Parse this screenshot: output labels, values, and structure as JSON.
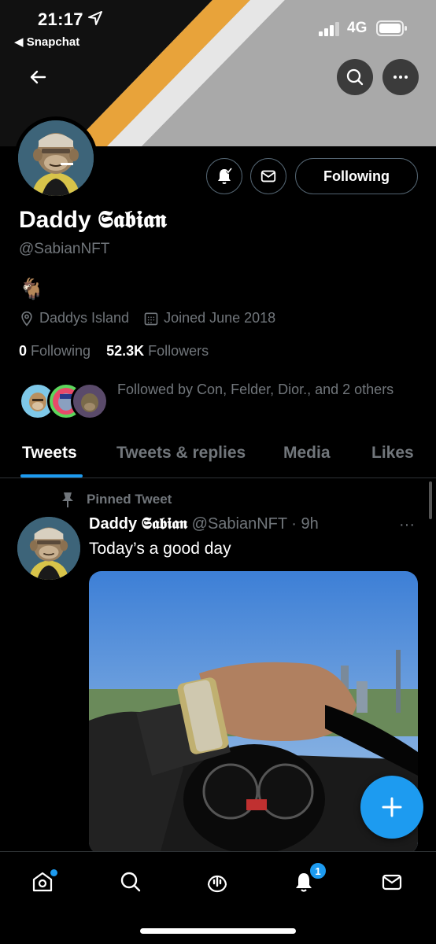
{
  "status_bar": {
    "time": "21:17",
    "back_app": "◀ Snapchat",
    "network": "4G"
  },
  "profile": {
    "name": "Daddy 𝕾𝖆𝖇𝖎𝖆𝖓",
    "handle": "@SabianNFT",
    "bio": "🐐",
    "location": "Daddys Island",
    "joined": "Joined June 2018",
    "following_count": "0",
    "following_label": "Following",
    "followers_count": "52.3K",
    "followers_label": "Followers",
    "followed_by": "Followed by Con, Felder, Dior., and 2 others",
    "following_button": "Following"
  },
  "tabs": [
    {
      "label": "Tweets"
    },
    {
      "label": "Tweets & replies"
    },
    {
      "label": "Media"
    },
    {
      "label": "Likes"
    }
  ],
  "tweet": {
    "pinned_label": "Pinned Tweet",
    "author_name": "Daddy 𝕾𝖆𝖇𝖎𝖆𝖓",
    "author_handle_time": "@SabianNFT · 9h",
    "more": "···",
    "text": "Today’s a good day"
  },
  "bottom_nav": {
    "notifications_badge": "1"
  },
  "colors": {
    "accent": "#1d9bf0",
    "background": "#000000",
    "secondary_text": "#71767b",
    "banner_orange": "#e8a33a"
  },
  "icons": [
    "back-arrow-icon",
    "search-icon",
    "more-icon",
    "bell-subscribed-icon",
    "mail-icon",
    "location-icon",
    "calendar-icon",
    "pin-icon",
    "compose-plus-icon",
    "home-icon",
    "spaces-icon",
    "bell-icon"
  ]
}
